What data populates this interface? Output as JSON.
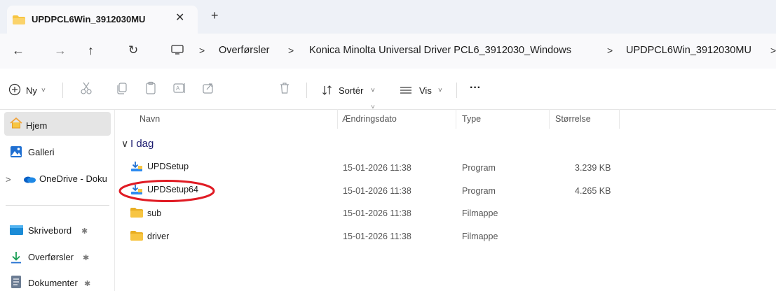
{
  "tab": {
    "title": "UPDPCL6Win_3912030MU",
    "close": "✕",
    "new": "+"
  },
  "nav": {
    "back": "←",
    "forward": "→",
    "up": "↑",
    "refresh": "↻"
  },
  "breadcrumb": {
    "sep": ">",
    "items": [
      "Overførsler",
      "Konica Minolta Universal Driver PCL6_3912030_Windows",
      "UPDPCL6Win_3912030MU"
    ]
  },
  "toolbar": {
    "new_label": "Ny",
    "sort_label": "Sortér",
    "view_label": "Vis",
    "more_label": "···",
    "chev": "˅"
  },
  "sidebar": {
    "items": [
      {
        "label": "Hjem",
        "icon": "home-icon"
      },
      {
        "label": "Galleri",
        "icon": "gallery-icon"
      },
      {
        "label": "OneDrive - Doku",
        "icon": "onedrive-icon"
      },
      {
        "label": "Skrivebord",
        "icon": "desktop-icon"
      },
      {
        "label": "Overførsler",
        "icon": "download-icon"
      },
      {
        "label": "Dokumenter",
        "icon": "documents-icon"
      }
    ],
    "expand": ">",
    "pin": "✱"
  },
  "columns": {
    "name": "Navn",
    "date": "Ændringsdato",
    "type": "Type",
    "size": "Størrelse"
  },
  "group": {
    "label": "I dag",
    "chev": "∨"
  },
  "files": [
    {
      "name": "UPDSetup",
      "date": "15-01-2026 11:38",
      "type": "Program",
      "size": "3.239 KB",
      "icon": "installer-icon"
    },
    {
      "name": "UPDSetup64",
      "date": "15-01-2026 11:38",
      "type": "Program",
      "size": "4.265 KB",
      "icon": "installer-icon"
    },
    {
      "name": "sub",
      "date": "15-01-2026 11:38",
      "type": "Filmappe",
      "size": "",
      "icon": "folder-icon"
    },
    {
      "name": "driver",
      "date": "15-01-2026 11:38",
      "type": "Filmappe",
      "size": "",
      "icon": "folder-icon"
    }
  ],
  "colors": {
    "accent": "#0067c0",
    "folder": "#f7c543",
    "highlight_oval": "#e01b24"
  }
}
